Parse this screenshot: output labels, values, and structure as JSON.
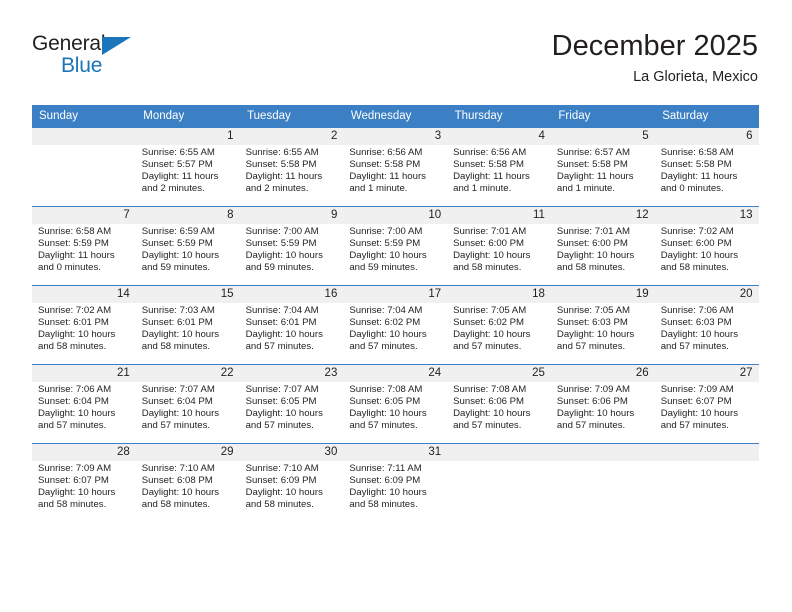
{
  "brand": {
    "name_part1": "General",
    "name_part2": "Blue",
    "triangle_color": "#1b75bb"
  },
  "header": {
    "title": "December 2025",
    "subtitle": "La Glorieta, Mexico"
  },
  "colors": {
    "header_blue": "#3b7fc4",
    "daynum_band": "#f0f0f0",
    "text": "#231f20"
  },
  "weekdays": [
    "Sunday",
    "Monday",
    "Tuesday",
    "Wednesday",
    "Thursday",
    "Friday",
    "Saturday"
  ],
  "weeks": [
    [
      {
        "day": "",
        "sunrise": "",
        "sunset": "",
        "daylight_line1": "",
        "daylight_line2": ""
      },
      {
        "day": "1",
        "sunrise": "Sunrise: 6:55 AM",
        "sunset": "Sunset: 5:57 PM",
        "daylight_line1": "Daylight: 11 hours",
        "daylight_line2": "and 2 minutes."
      },
      {
        "day": "2",
        "sunrise": "Sunrise: 6:55 AM",
        "sunset": "Sunset: 5:58 PM",
        "daylight_line1": "Daylight: 11 hours",
        "daylight_line2": "and 2 minutes."
      },
      {
        "day": "3",
        "sunrise": "Sunrise: 6:56 AM",
        "sunset": "Sunset: 5:58 PM",
        "daylight_line1": "Daylight: 11 hours",
        "daylight_line2": "and 1 minute."
      },
      {
        "day": "4",
        "sunrise": "Sunrise: 6:56 AM",
        "sunset": "Sunset: 5:58 PM",
        "daylight_line1": "Daylight: 11 hours",
        "daylight_line2": "and 1 minute."
      },
      {
        "day": "5",
        "sunrise": "Sunrise: 6:57 AM",
        "sunset": "Sunset: 5:58 PM",
        "daylight_line1": "Daylight: 11 hours",
        "daylight_line2": "and 1 minute."
      },
      {
        "day": "6",
        "sunrise": "Sunrise: 6:58 AM",
        "sunset": "Sunset: 5:58 PM",
        "daylight_line1": "Daylight: 11 hours",
        "daylight_line2": "and 0 minutes."
      }
    ],
    [
      {
        "day": "7",
        "sunrise": "Sunrise: 6:58 AM",
        "sunset": "Sunset: 5:59 PM",
        "daylight_line1": "Daylight: 11 hours",
        "daylight_line2": "and 0 minutes."
      },
      {
        "day": "8",
        "sunrise": "Sunrise: 6:59 AM",
        "sunset": "Sunset: 5:59 PM",
        "daylight_line1": "Daylight: 10 hours",
        "daylight_line2": "and 59 minutes."
      },
      {
        "day": "9",
        "sunrise": "Sunrise: 7:00 AM",
        "sunset": "Sunset: 5:59 PM",
        "daylight_line1": "Daylight: 10 hours",
        "daylight_line2": "and 59 minutes."
      },
      {
        "day": "10",
        "sunrise": "Sunrise: 7:00 AM",
        "sunset": "Sunset: 5:59 PM",
        "daylight_line1": "Daylight: 10 hours",
        "daylight_line2": "and 59 minutes."
      },
      {
        "day": "11",
        "sunrise": "Sunrise: 7:01 AM",
        "sunset": "Sunset: 6:00 PM",
        "daylight_line1": "Daylight: 10 hours",
        "daylight_line2": "and 58 minutes."
      },
      {
        "day": "12",
        "sunrise": "Sunrise: 7:01 AM",
        "sunset": "Sunset: 6:00 PM",
        "daylight_line1": "Daylight: 10 hours",
        "daylight_line2": "and 58 minutes."
      },
      {
        "day": "13",
        "sunrise": "Sunrise: 7:02 AM",
        "sunset": "Sunset: 6:00 PM",
        "daylight_line1": "Daylight: 10 hours",
        "daylight_line2": "and 58 minutes."
      }
    ],
    [
      {
        "day": "14",
        "sunrise": "Sunrise: 7:02 AM",
        "sunset": "Sunset: 6:01 PM",
        "daylight_line1": "Daylight: 10 hours",
        "daylight_line2": "and 58 minutes."
      },
      {
        "day": "15",
        "sunrise": "Sunrise: 7:03 AM",
        "sunset": "Sunset: 6:01 PM",
        "daylight_line1": "Daylight: 10 hours",
        "daylight_line2": "and 58 minutes."
      },
      {
        "day": "16",
        "sunrise": "Sunrise: 7:04 AM",
        "sunset": "Sunset: 6:01 PM",
        "daylight_line1": "Daylight: 10 hours",
        "daylight_line2": "and 57 minutes."
      },
      {
        "day": "17",
        "sunrise": "Sunrise: 7:04 AM",
        "sunset": "Sunset: 6:02 PM",
        "daylight_line1": "Daylight: 10 hours",
        "daylight_line2": "and 57 minutes."
      },
      {
        "day": "18",
        "sunrise": "Sunrise: 7:05 AM",
        "sunset": "Sunset: 6:02 PM",
        "daylight_line1": "Daylight: 10 hours",
        "daylight_line2": "and 57 minutes."
      },
      {
        "day": "19",
        "sunrise": "Sunrise: 7:05 AM",
        "sunset": "Sunset: 6:03 PM",
        "daylight_line1": "Daylight: 10 hours",
        "daylight_line2": "and 57 minutes."
      },
      {
        "day": "20",
        "sunrise": "Sunrise: 7:06 AM",
        "sunset": "Sunset: 6:03 PM",
        "daylight_line1": "Daylight: 10 hours",
        "daylight_line2": "and 57 minutes."
      }
    ],
    [
      {
        "day": "21",
        "sunrise": "Sunrise: 7:06 AM",
        "sunset": "Sunset: 6:04 PM",
        "daylight_line1": "Daylight: 10 hours",
        "daylight_line2": "and 57 minutes."
      },
      {
        "day": "22",
        "sunrise": "Sunrise: 7:07 AM",
        "sunset": "Sunset: 6:04 PM",
        "daylight_line1": "Daylight: 10 hours",
        "daylight_line2": "and 57 minutes."
      },
      {
        "day": "23",
        "sunrise": "Sunrise: 7:07 AM",
        "sunset": "Sunset: 6:05 PM",
        "daylight_line1": "Daylight: 10 hours",
        "daylight_line2": "and 57 minutes."
      },
      {
        "day": "24",
        "sunrise": "Sunrise: 7:08 AM",
        "sunset": "Sunset: 6:05 PM",
        "daylight_line1": "Daylight: 10 hours",
        "daylight_line2": "and 57 minutes."
      },
      {
        "day": "25",
        "sunrise": "Sunrise: 7:08 AM",
        "sunset": "Sunset: 6:06 PM",
        "daylight_line1": "Daylight: 10 hours",
        "daylight_line2": "and 57 minutes."
      },
      {
        "day": "26",
        "sunrise": "Sunrise: 7:09 AM",
        "sunset": "Sunset: 6:06 PM",
        "daylight_line1": "Daylight: 10 hours",
        "daylight_line2": "and 57 minutes."
      },
      {
        "day": "27",
        "sunrise": "Sunrise: 7:09 AM",
        "sunset": "Sunset: 6:07 PM",
        "daylight_line1": "Daylight: 10 hours",
        "daylight_line2": "and 57 minutes."
      }
    ],
    [
      {
        "day": "28",
        "sunrise": "Sunrise: 7:09 AM",
        "sunset": "Sunset: 6:07 PM",
        "daylight_line1": "Daylight: 10 hours",
        "daylight_line2": "and 58 minutes."
      },
      {
        "day": "29",
        "sunrise": "Sunrise: 7:10 AM",
        "sunset": "Sunset: 6:08 PM",
        "daylight_line1": "Daylight: 10 hours",
        "daylight_line2": "and 58 minutes."
      },
      {
        "day": "30",
        "sunrise": "Sunrise: 7:10 AM",
        "sunset": "Sunset: 6:09 PM",
        "daylight_line1": "Daylight: 10 hours",
        "daylight_line2": "and 58 minutes."
      },
      {
        "day": "31",
        "sunrise": "Sunrise: 7:11 AM",
        "sunset": "Sunset: 6:09 PM",
        "daylight_line1": "Daylight: 10 hours",
        "daylight_line2": "and 58 minutes."
      },
      {
        "day": "",
        "sunrise": "",
        "sunset": "",
        "daylight_line1": "",
        "daylight_line2": ""
      },
      {
        "day": "",
        "sunrise": "",
        "sunset": "",
        "daylight_line1": "",
        "daylight_line2": ""
      },
      {
        "day": "",
        "sunrise": "",
        "sunset": "",
        "daylight_line1": "",
        "daylight_line2": ""
      }
    ]
  ]
}
